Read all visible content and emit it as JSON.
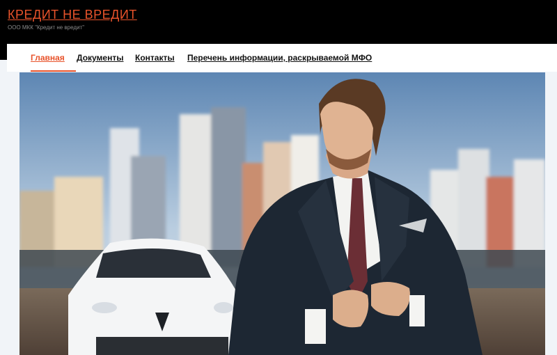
{
  "header": {
    "site_title": "КРЕДИТ НЕ ВРЕДИТ",
    "tagline": "ООО МКК \"Кредит не вредит\""
  },
  "nav": {
    "items": [
      {
        "label": "Главная",
        "active": true
      },
      {
        "label": "Документы",
        "active": false
      },
      {
        "label": "Контакты",
        "active": false
      },
      {
        "label": "Перечень информации, раскрываемой МФО",
        "active": false
      }
    ]
  },
  "hero": {
    "image": "businessman-in-suit-with-white-car-city-skyline"
  },
  "colors": {
    "accent": "#e8532b",
    "header_bg": "#000000",
    "nav_bg": "#ffffff",
    "page_bg": "#f1f4f8"
  }
}
